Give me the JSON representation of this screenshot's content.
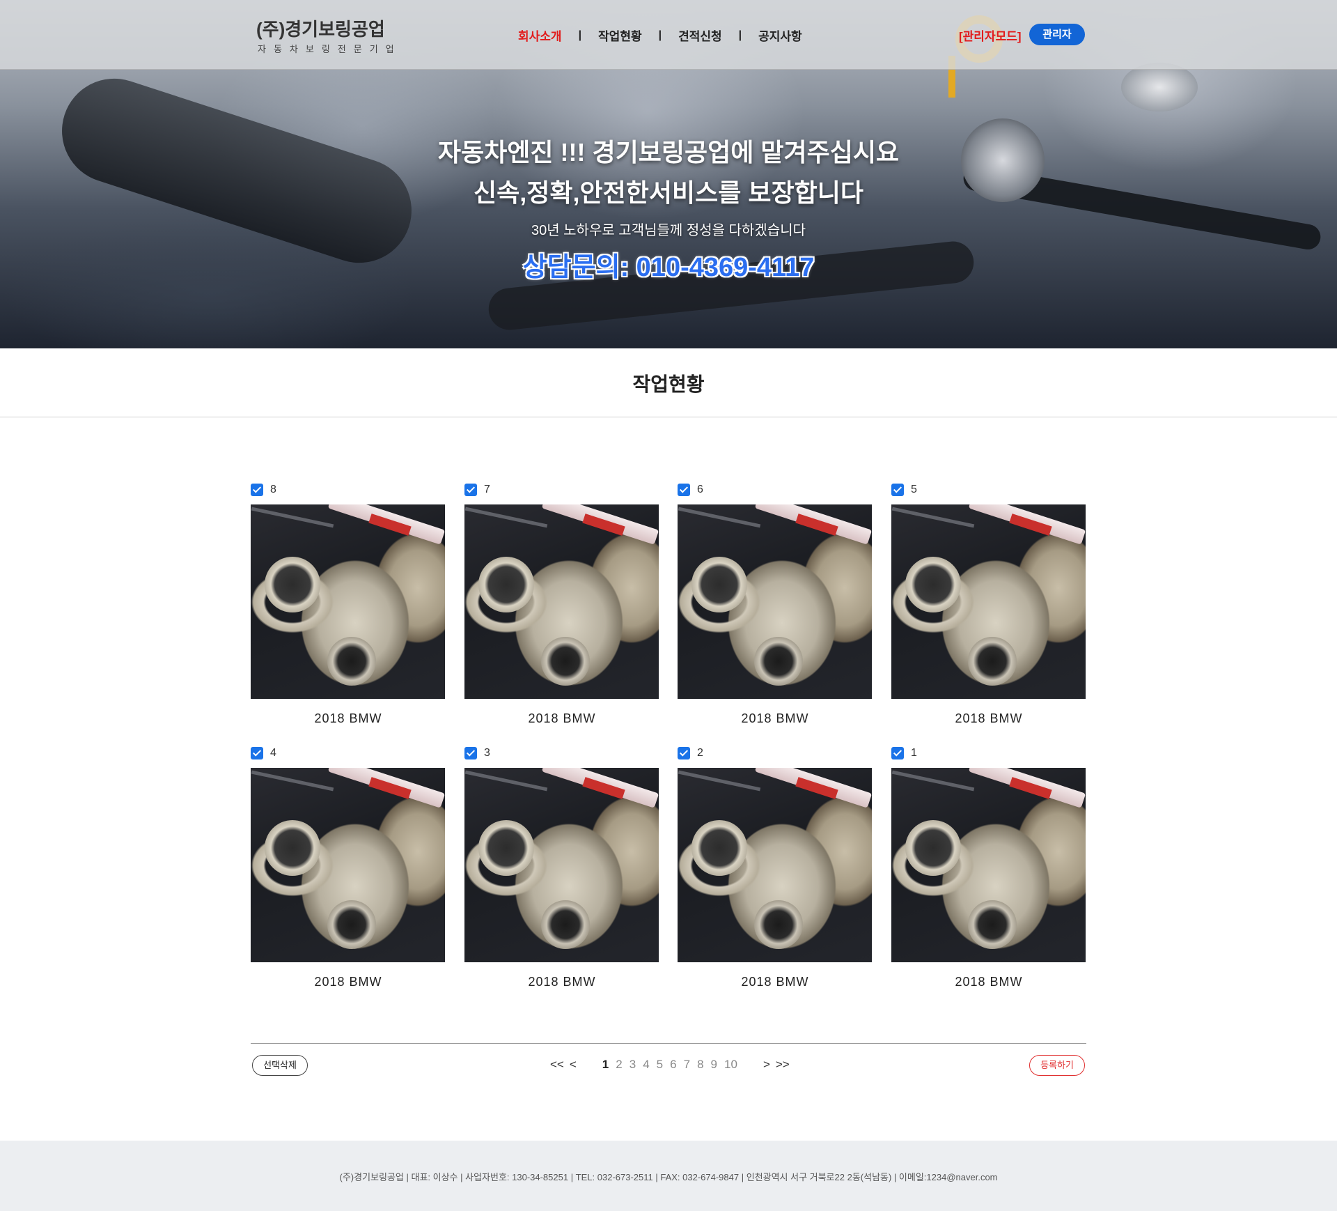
{
  "header": {
    "logo_title": "(주)경기보링공업",
    "logo_subtitle": "자동차보링전문기업",
    "nav": [
      {
        "label": "회사소개",
        "active": true
      },
      {
        "label": "작업현황",
        "active": false
      },
      {
        "label": "견적신청",
        "active": false
      },
      {
        "label": "공지사항",
        "active": false
      }
    ],
    "nav_separator": "|",
    "admin_mode_label": "[관리자모드]",
    "admin_button_label": "관리자"
  },
  "hero": {
    "line1": "자동차엔진 !!! 경기보링공업에 맡겨주십시요",
    "line2": "신속,정확,안전한서비스를 보장합니다",
    "line3": "30년 노하우로 고객님들께 정성을 다하겠습니다",
    "phone": "상담문의: 010-4369-4117"
  },
  "section": {
    "title": "작업현황"
  },
  "gallery": {
    "items": [
      {
        "number": "8",
        "caption": "2018 BMW",
        "checked": true
      },
      {
        "number": "7",
        "caption": "2018 BMW",
        "checked": true
      },
      {
        "number": "6",
        "caption": "2018 BMW",
        "checked": true
      },
      {
        "number": "5",
        "caption": "2018 BMW",
        "checked": true
      },
      {
        "number": "4",
        "caption": "2018 BMW",
        "checked": true
      },
      {
        "number": "3",
        "caption": "2018 BMW",
        "checked": true
      },
      {
        "number": "2",
        "caption": "2018 BMW",
        "checked": true
      },
      {
        "number": "1",
        "caption": "2018 BMW",
        "checked": true
      }
    ]
  },
  "actions": {
    "delete_label": "선택삭제",
    "register_label": "등록하기"
  },
  "pagination": {
    "first": "<<",
    "prev": "<",
    "pages": [
      "1",
      "2",
      "3",
      "4",
      "5",
      "6",
      "7",
      "8",
      "9",
      "10"
    ],
    "current": "1",
    "next": ">",
    "last": ">>"
  },
  "footer": {
    "text": "(주)경기보링공업   |  대표: 이상수  |  사업자번호: 130-34-85251  |  TEL: 032-673-2511  |  FAX: 032-674-9847  |  인천광역시 서구 거북로22 2동(석남동)   |  이메일:1234@naver.com"
  },
  "colors": {
    "accent_red": "#e21b1b",
    "admin_blue": "#1265d6",
    "checkbox_blue": "#1a73e8",
    "phone_blue": "#2b6ef0"
  }
}
